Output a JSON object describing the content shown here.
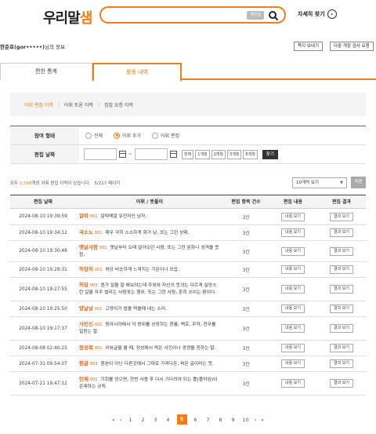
{
  "header": {
    "logo_text": "우리말",
    "logo_accent": "샘",
    "search_option": "옛한글",
    "detail_search": "자세히 찾기"
  },
  "user": {
    "name": "한준호(gor•••••)",
    "suffix": "님의 정보",
    "buttons": [
      "쪽지 보내기",
      "다중 개정 검사 요청"
    ]
  },
  "tabs": [
    "편찬 통계",
    "활동 내역"
  ],
  "active_tab": "활동 내역",
  "submenu": [
    "어휘 편집 이력",
    "어휘 토론 이력",
    "집필 요청 이력"
  ],
  "filter": {
    "type_label": "참여 형태",
    "type_options": [
      "전체",
      "어휘 추가",
      "어휘 편집"
    ],
    "type_selected": "어휘 추가",
    "date_label": "편집 날짜",
    "date_tilde": "~",
    "periods": [
      "전체",
      "1개월",
      "2개월",
      "3개월",
      "6개월"
    ],
    "find_button": "찾기"
  },
  "summary": {
    "prefix": "모두 ",
    "count": "2,168",
    "middle": "개의 어휘 편집 이력이 있습니다.",
    "page": "5",
    "page_total": "/217 페이지"
  },
  "per_page": "10개씩 보기",
  "apply_button": "적용",
  "table": {
    "headers": [
      "편집 날짜",
      "어휘 / 뜻풀이",
      "편집 항목 건수",
      "편집 내용",
      "편집 결과"
    ],
    "view_label": "내용 보기",
    "result_label": "결과 보기",
    "rows": [
      {
        "date": "2024-08-10 19:39:59",
        "word": "알따",
        "num": "001",
        "def": "알따메얼 유전자인 남자.",
        "count": "3건"
      },
      {
        "date": "2024-08-10 19:34:12",
        "word": "극소노",
        "num": "001",
        "def": "매우 극히 소소하게 화가 남. 또는 그런 상태.",
        "count": "3건"
      },
      {
        "date": "2024-08-10 19:30:48",
        "word": "옛날사람",
        "num": "001",
        "def": "옛날부터 오래 살아오던 사람. 또는 그런 문화나 성격을 뜻함.",
        "count": "3건"
      },
      {
        "date": "2024-08-10 19:28:31",
        "word": "허당끼",
        "num": "001",
        "def": "허당 비슷하게 느껴지는 기운이나 모습.",
        "count": "3건"
      },
      {
        "date": "2024-08-10 19:27:55",
        "word": "허당",
        "num": "003",
        "def": "뭔가 일을 잘 해보려는데 주위와 자신의 뜻과는 다르게 실망스런 일을 자주 벌리는 사람포는 행위. 또는 그런 사람, 흔히 쓰이는 편이다.",
        "count": "3건"
      },
      {
        "date": "2024-08-10 19:25:50",
        "word": "양날낭",
        "num": "001",
        "def": "고양이가 밥을 먹을때 내는 소리.",
        "count": "3건"
      },
      {
        "date": "2024-08-10 19:17:37",
        "word": "사빈신",
        "num": "001",
        "def": "동아시아에서 각 방위를 상징하는 청룡, 백호, 주작, 현무를 일컫는 말.",
        "count": "3건"
      },
      {
        "date": "2024-08-08 02:40:25",
        "word": "정성복",
        "num": "001",
        "def": "리뷰글을 올 때, 정성에서 찍은 사진이나 광경을 칭하는 말.",
        "count": "3건"
      },
      {
        "date": "2024-07-31 09:54:07",
        "word": "펌글",
        "num": "003",
        "def": "원본이 아닌 다른곳에서 그대로 가져다온, 퍼온 글이라는 뜻.",
        "count": "3건"
      },
      {
        "date": "2024-07-21 19:47:12",
        "word": "턴제",
        "num": "001",
        "def": "기회를 얻으면, 한번 사용 후 다시 기다려야 되는 틀(플티임)이 존재하는 규칙.",
        "count": "3건"
      }
    ]
  },
  "pager": {
    "first": "«",
    "prev": "‹",
    "pages": [
      "1",
      "2",
      "3",
      "4",
      "5",
      "6",
      "7",
      "8",
      "9",
      "10"
    ],
    "current": "5",
    "next": "›",
    "last": "»"
  },
  "colors": {
    "accent": "#f07d1a",
    "word": "#e2661a"
  }
}
